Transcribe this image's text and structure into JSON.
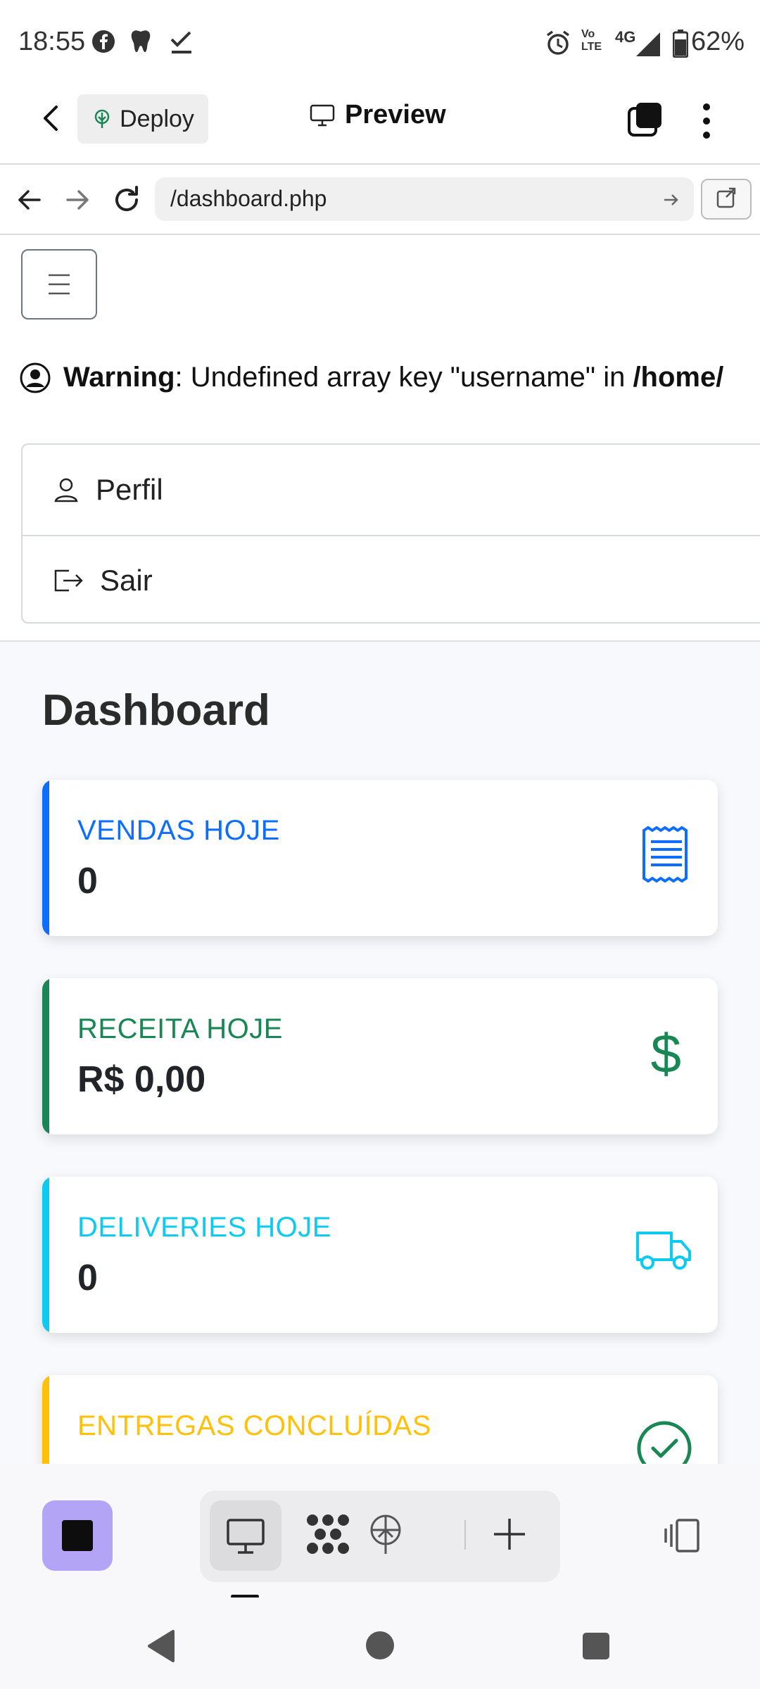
{
  "status_bar": {
    "time": "18:55",
    "network": "4G",
    "battery": "62%"
  },
  "app_header": {
    "deploy_label": "Deploy",
    "preview_label": "Preview"
  },
  "browser": {
    "url": "/dashboard.php"
  },
  "page": {
    "warning": {
      "bold_label": "Warning",
      "message": ": Undefined array key \"username\" in ",
      "path": "/home/"
    },
    "menu": [
      {
        "label": "Perfil"
      },
      {
        "label": "Sair"
      }
    ],
    "title": "Dashboard",
    "cards": [
      {
        "label": "VENDAS HOJE",
        "value": "0",
        "color": "#0d6efd",
        "icon": "receipt-icon"
      },
      {
        "label": "RECEITA HOJE",
        "value": "R$ 0,00",
        "color": "#198754",
        "icon": "dollar-icon"
      },
      {
        "label": "DELIVERIES HOJE",
        "value": "0",
        "color": "#0dcaf0",
        "icon": "truck-icon"
      },
      {
        "label": "ENTREGAS CONCLUÍDAS",
        "value": "",
        "color": "#ffc107",
        "icon": "check-circle-icon"
      }
    ]
  },
  "colors": {
    "stop_button": "#b4a4f5",
    "primary": "#0d6efd",
    "success": "#198754",
    "info": "#0dcaf0",
    "warning": "#ffc107"
  }
}
